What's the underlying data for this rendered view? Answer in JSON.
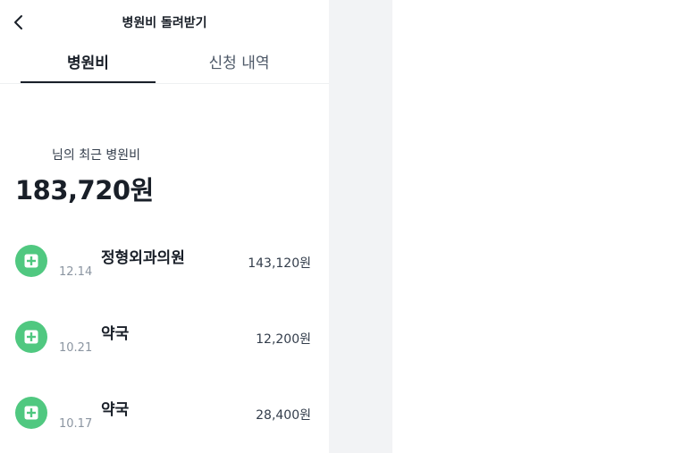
{
  "header": {
    "title": "병원비 돌려받기"
  },
  "tabs": [
    {
      "label": "병원비",
      "active": true
    },
    {
      "label": "신청 내역",
      "active": false
    }
  ],
  "summary": {
    "label": "님의 최근 병원비",
    "total": "183,720원"
  },
  "records": [
    {
      "name": "정형외과의원",
      "date": "12.14",
      "amount": "143,120원",
      "icon": "plus-medical-icon"
    },
    {
      "name": "약국",
      "date": "10.21",
      "amount": "12,200원",
      "icon": "plus-medical-icon"
    },
    {
      "name": "약국",
      "date": "10.17",
      "amount": "28,400원",
      "icon": "plus-medical-icon"
    }
  ],
  "colors": {
    "accent_green": "#50c880",
    "text_primary": "#191f28",
    "panel_gray": "#f2f3f5"
  }
}
